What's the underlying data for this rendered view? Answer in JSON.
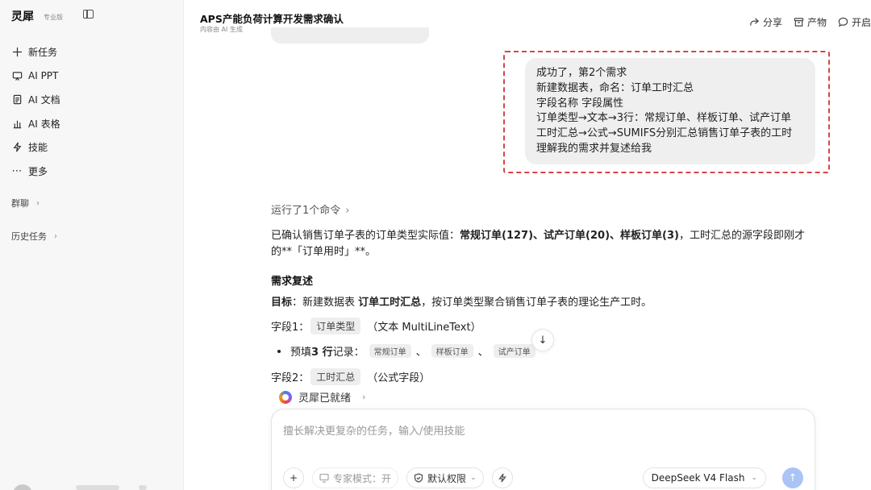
{
  "sidebar": {
    "brand": "灵犀",
    "badge": "专业版",
    "items": [
      {
        "label": "新任务",
        "icon": "plus-icon"
      },
      {
        "label": "AI PPT",
        "icon": "presentation-icon"
      },
      {
        "label": "AI 文档",
        "icon": "document-icon"
      },
      {
        "label": "AI 表格",
        "icon": "bar-chart-icon"
      },
      {
        "label": "技能",
        "icon": "lightning-icon"
      },
      {
        "label": "更多",
        "icon": "more-icon"
      }
    ],
    "group_chat": "群聊",
    "history": "历史任务"
  },
  "header": {
    "title": "APS产能负荷计算开发需求确认",
    "subtitle": "内容由 AI 生成",
    "share": "分享",
    "output": "产物",
    "open": "开启"
  },
  "user_message": {
    "lines": [
      "成功了，第2个需求",
      "新建数据表，命名：订单工时汇总",
      "字段名称 字段属性",
      "订单类型→文本→3行：常规订单、样板订单、试产订单",
      "工时汇总→公式→SUMIFS分别汇总销售订单子表的工时",
      "理解我的需求并复述给我"
    ]
  },
  "assistant": {
    "run_command": "运行了1个命令",
    "para_prefix": "已确认销售订单子表的订单类型实际值：",
    "para_bold": "常规订单(127)、试产订单(20)、样板订单(3)",
    "para_suffix": "，工时汇总的源字段即刚才的**「订单用时」**。",
    "recap_heading": "需求复述",
    "goal_label": "目标",
    "goal_prefix": "：新建数据表 ",
    "goal_table": "订单工时汇总",
    "goal_suffix": "，按订单类型聚合销售订单子表的理论生产工时。",
    "field1_label": "字段1：",
    "field1_name": "订单类型",
    "field1_type": "（文本 MultiLineText）",
    "prefill_prefix": "预填 ",
    "prefill_count": "3 行",
    "prefill_suffix": "记录：",
    "prefill_values": [
      "常规订单",
      "样板订单",
      "试产订单"
    ],
    "sep": "、",
    "field2_label": "字段2：",
    "field2_name": "工时汇总",
    "field2_type": "（公式字段）",
    "ready": "灵犀已就绪"
  },
  "composer": {
    "placeholder": "擅长解决更复杂的任务，输入/使用技能",
    "expert_mode": "专家模式：开",
    "permission": "默认权限",
    "model": "DeepSeek V4 Flash"
  },
  "colors": {
    "highlight": "#d64545",
    "send": "#a9c4f5"
  }
}
